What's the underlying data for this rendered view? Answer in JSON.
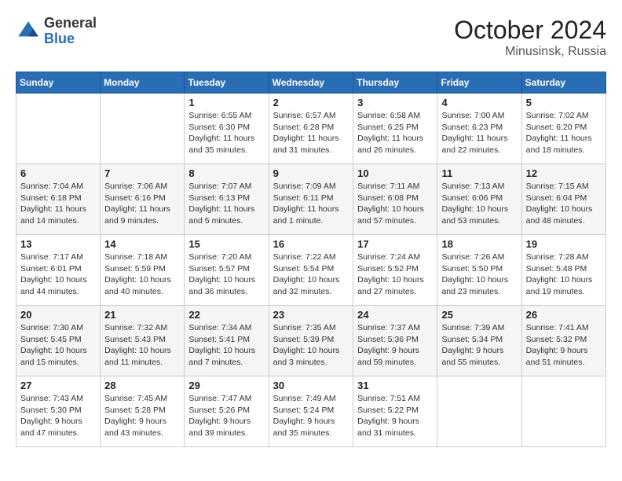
{
  "header": {
    "logo_general": "General",
    "logo_blue": "Blue",
    "month_title": "October 2024",
    "location": "Minusinsk, Russia"
  },
  "days_of_week": [
    "Sunday",
    "Monday",
    "Tuesday",
    "Wednesday",
    "Thursday",
    "Friday",
    "Saturday"
  ],
  "weeks": [
    [
      {
        "day": "",
        "info": ""
      },
      {
        "day": "",
        "info": ""
      },
      {
        "day": "1",
        "info": "Sunrise: 6:55 AM\nSunset: 6:30 PM\nDaylight: 11 hours and 35 minutes."
      },
      {
        "day": "2",
        "info": "Sunrise: 6:57 AM\nSunset: 6:28 PM\nDaylight: 11 hours and 31 minutes."
      },
      {
        "day": "3",
        "info": "Sunrise: 6:58 AM\nSunset: 6:25 PM\nDaylight: 11 hours and 26 minutes."
      },
      {
        "day": "4",
        "info": "Sunrise: 7:00 AM\nSunset: 6:23 PM\nDaylight: 11 hours and 22 minutes."
      },
      {
        "day": "5",
        "info": "Sunrise: 7:02 AM\nSunset: 6:20 PM\nDaylight: 11 hours and 18 minutes."
      }
    ],
    [
      {
        "day": "6",
        "info": "Sunrise: 7:04 AM\nSunset: 6:18 PM\nDaylight: 11 hours and 14 minutes."
      },
      {
        "day": "7",
        "info": "Sunrise: 7:06 AM\nSunset: 6:16 PM\nDaylight: 11 hours and 9 minutes."
      },
      {
        "day": "8",
        "info": "Sunrise: 7:07 AM\nSunset: 6:13 PM\nDaylight: 11 hours and 5 minutes."
      },
      {
        "day": "9",
        "info": "Sunrise: 7:09 AM\nSunset: 6:11 PM\nDaylight: 11 hours and 1 minute."
      },
      {
        "day": "10",
        "info": "Sunrise: 7:11 AM\nSunset: 6:08 PM\nDaylight: 10 hours and 57 minutes."
      },
      {
        "day": "11",
        "info": "Sunrise: 7:13 AM\nSunset: 6:06 PM\nDaylight: 10 hours and 53 minutes."
      },
      {
        "day": "12",
        "info": "Sunrise: 7:15 AM\nSunset: 6:04 PM\nDaylight: 10 hours and 48 minutes."
      }
    ],
    [
      {
        "day": "13",
        "info": "Sunrise: 7:17 AM\nSunset: 6:01 PM\nDaylight: 10 hours and 44 minutes."
      },
      {
        "day": "14",
        "info": "Sunrise: 7:18 AM\nSunset: 5:59 PM\nDaylight: 10 hours and 40 minutes."
      },
      {
        "day": "15",
        "info": "Sunrise: 7:20 AM\nSunset: 5:57 PM\nDaylight: 10 hours and 36 minutes."
      },
      {
        "day": "16",
        "info": "Sunrise: 7:22 AM\nSunset: 5:54 PM\nDaylight: 10 hours and 32 minutes."
      },
      {
        "day": "17",
        "info": "Sunrise: 7:24 AM\nSunset: 5:52 PM\nDaylight: 10 hours and 27 minutes."
      },
      {
        "day": "18",
        "info": "Sunrise: 7:26 AM\nSunset: 5:50 PM\nDaylight: 10 hours and 23 minutes."
      },
      {
        "day": "19",
        "info": "Sunrise: 7:28 AM\nSunset: 5:48 PM\nDaylight: 10 hours and 19 minutes."
      }
    ],
    [
      {
        "day": "20",
        "info": "Sunrise: 7:30 AM\nSunset: 5:45 PM\nDaylight: 10 hours and 15 minutes."
      },
      {
        "day": "21",
        "info": "Sunrise: 7:32 AM\nSunset: 5:43 PM\nDaylight: 10 hours and 11 minutes."
      },
      {
        "day": "22",
        "info": "Sunrise: 7:34 AM\nSunset: 5:41 PM\nDaylight: 10 hours and 7 minutes."
      },
      {
        "day": "23",
        "info": "Sunrise: 7:35 AM\nSunset: 5:39 PM\nDaylight: 10 hours and 3 minutes."
      },
      {
        "day": "24",
        "info": "Sunrise: 7:37 AM\nSunset: 5:36 PM\nDaylight: 9 hours and 59 minutes."
      },
      {
        "day": "25",
        "info": "Sunrise: 7:39 AM\nSunset: 5:34 PM\nDaylight: 9 hours and 55 minutes."
      },
      {
        "day": "26",
        "info": "Sunrise: 7:41 AM\nSunset: 5:32 PM\nDaylight: 9 hours and 51 minutes."
      }
    ],
    [
      {
        "day": "27",
        "info": "Sunrise: 7:43 AM\nSunset: 5:30 PM\nDaylight: 9 hours and 47 minutes."
      },
      {
        "day": "28",
        "info": "Sunrise: 7:45 AM\nSunset: 5:28 PM\nDaylight: 9 hours and 43 minutes."
      },
      {
        "day": "29",
        "info": "Sunrise: 7:47 AM\nSunset: 5:26 PM\nDaylight: 9 hours and 39 minutes."
      },
      {
        "day": "30",
        "info": "Sunrise: 7:49 AM\nSunset: 5:24 PM\nDaylight: 9 hours and 35 minutes."
      },
      {
        "day": "31",
        "info": "Sunrise: 7:51 AM\nSunset: 5:22 PM\nDaylight: 9 hours and 31 minutes."
      },
      {
        "day": "",
        "info": ""
      },
      {
        "day": "",
        "info": ""
      }
    ]
  ]
}
